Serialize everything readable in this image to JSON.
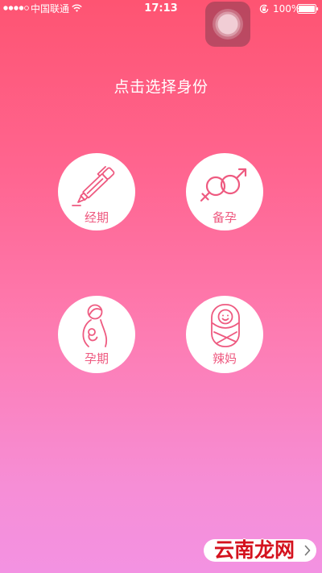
{
  "status_bar": {
    "signal_icon": "signal-strength-icon",
    "carrier": "中国联通",
    "wifi_icon": "wifi-icon",
    "time": "17:13",
    "rotation_lock_icon": "rotation-lock-icon",
    "battery_percent": "100%",
    "battery_icon": "battery-icon",
    "battery_level": 1.0
  },
  "assistive_touch": {
    "icon": "assistive-touch-icon"
  },
  "title": "点击选择身份",
  "identities": [
    {
      "label": "经期",
      "icon": "pen-icon"
    },
    {
      "label": "备孕",
      "icon": "gender-symbols-icon"
    },
    {
      "label": "孕期",
      "icon": "pregnant-woman-icon"
    },
    {
      "label": "辣妈",
      "icon": "swaddled-baby-icon"
    }
  ],
  "login_button": {
    "chevron_icon": "chevron-right-icon"
  },
  "watermark": "云南龙网",
  "colors": {
    "accent": "#ee5a80",
    "background_top": "#fe5472",
    "background_bottom": "#f392e2",
    "watermark": "#d4121e"
  }
}
